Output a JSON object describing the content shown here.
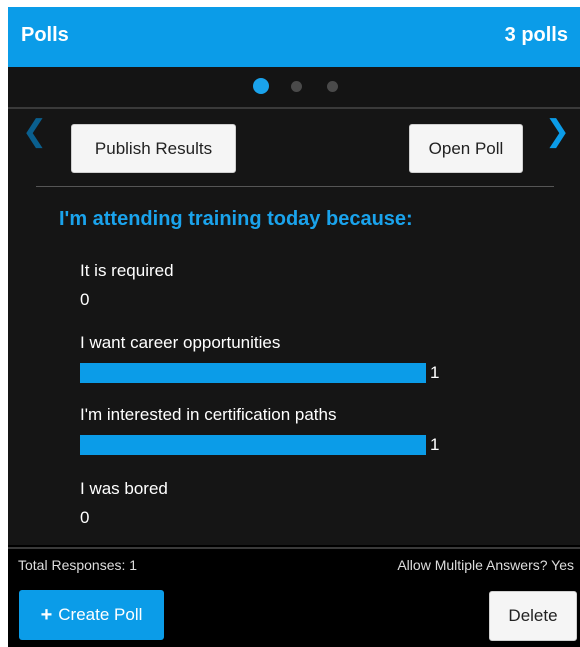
{
  "header": {
    "title": "Polls",
    "count": "3 polls"
  },
  "pager": {
    "total": 3,
    "active_index": 0
  },
  "nav": {
    "prev_icon": "chevron-left-icon",
    "next_icon": "chevron-right-icon"
  },
  "toolbar": {
    "publish_label": "Publish Results",
    "open_label": "Open Poll"
  },
  "poll": {
    "question": "I'm attending training today because:",
    "max_votes": 1,
    "options": [
      {
        "label": "It is required",
        "votes": 0
      },
      {
        "label": "I want career opportunities",
        "votes": 1
      },
      {
        "label": "I'm interested in certification paths",
        "votes": 1
      },
      {
        "label": "I was bored",
        "votes": 0
      }
    ]
  },
  "footer": {
    "total_responses": "Total Responses: 1",
    "allow_multiple": "Allow Multiple Answers? Yes"
  },
  "actions": {
    "create_label": "Create Poll",
    "delete_label": "Delete",
    "create_icon": "plus-icon"
  },
  "colors": {
    "accent": "#0b9ce8",
    "background": "#000000"
  }
}
